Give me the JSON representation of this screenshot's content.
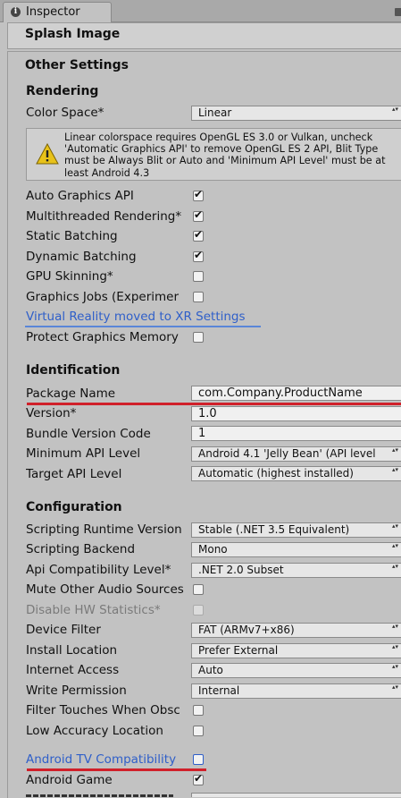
{
  "tab": {
    "title": "Inspector"
  },
  "sections": {
    "splash": "Splash Image",
    "other": "Other Settings",
    "rendering": "Rendering",
    "identification": "Identification",
    "configuration": "Configuration"
  },
  "rendering": {
    "color_space_label": "Color Space*",
    "color_space_value": "Linear",
    "warning_text": "Linear colorspace requires OpenGL ES 3.0 or Vulkan, uncheck 'Automatic Graphics API' to remove OpenGL ES 2 API, Blit Type must be Always Blit or Auto and 'Minimum API Level' must be at least Android 4.3",
    "auto_graphics_api": "Auto Graphics API",
    "multithreaded_rendering": "Multithreaded Rendering*",
    "static_batching": "Static Batching",
    "dynamic_batching": "Dynamic Batching",
    "gpu_skinning": "GPU Skinning*",
    "graphics_jobs": "Graphics Jobs (Experimer",
    "vr_link": "Virtual Reality moved to XR Settings",
    "protect_graphics_memory": "Protect Graphics Memory",
    "checks": {
      "auto_graphics_api": true,
      "multithreaded_rendering": true,
      "static_batching": true,
      "dynamic_batching": true,
      "gpu_skinning": false,
      "graphics_jobs": false,
      "protect_graphics_memory": false
    }
  },
  "identification": {
    "package_name_label": "Package Name",
    "package_name_value": "com.Company.ProductName",
    "version_label": "Version*",
    "version_value": "1.0",
    "bundle_version_label": "Bundle Version Code",
    "bundle_version_value": "1",
    "min_api_label": "Minimum API Level",
    "min_api_value": "Android 4.1 'Jelly Bean' (API level",
    "target_api_label": "Target API Level",
    "target_api_value": "Automatic (highest installed)"
  },
  "configuration": {
    "scripting_runtime_label": "Scripting Runtime Version",
    "scripting_runtime_value": "Stable (.NET 3.5 Equivalent)",
    "scripting_backend_label": "Scripting Backend",
    "scripting_backend_value": "Mono",
    "api_compat_label": "Api Compatibility Level*",
    "api_compat_value": ".NET 2.0 Subset",
    "mute_audio_label": "Mute Other Audio Sources",
    "disable_hw_label": "Disable HW Statistics*",
    "device_filter_label": "Device Filter",
    "device_filter_value": "FAT (ARMv7+x86)",
    "install_location_label": "Install Location",
    "install_location_value": "Prefer External",
    "internet_access_label": "Internet Access",
    "internet_access_value": "Auto",
    "write_permission_label": "Write Permission",
    "write_permission_value": "Internal",
    "filter_touches_label": "Filter Touches When Obsc",
    "low_accuracy_label": "Low Accuracy Location",
    "android_tv_label": "Android TV Compatibility",
    "android_game_label": "Android Game",
    "checks": {
      "mute_audio": false,
      "disable_hw": false,
      "filter_touches": false,
      "low_accuracy": false,
      "android_tv": false,
      "android_game": true
    }
  },
  "colors": {
    "highlight_underline": "#d0202a",
    "link": "#2f5fc9",
    "panel_bg": "#c2c2c2"
  }
}
